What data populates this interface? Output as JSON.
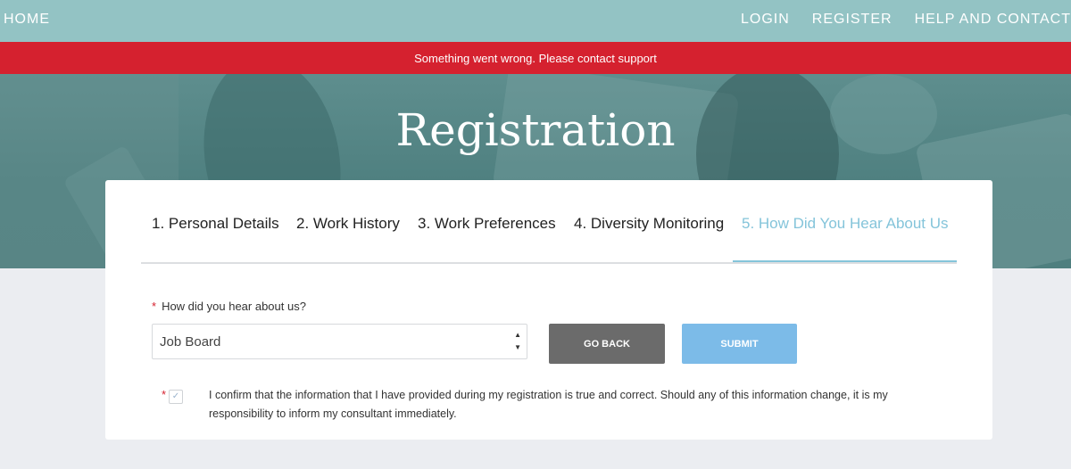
{
  "nav": {
    "home": "HOME",
    "login": "LOGIN",
    "register": "REGISTER",
    "help": "HELP AND CONTACT"
  },
  "error_banner": "Something went wrong. Please contact support",
  "hero": {
    "title": "Registration"
  },
  "steps": [
    {
      "label": "1. Personal Details",
      "active": false
    },
    {
      "label": "2. Work History",
      "active": false
    },
    {
      "label": "3. Work Preferences",
      "active": false
    },
    {
      "label": "4. Diversity Monitoring",
      "active": false
    },
    {
      "label": "5. How Did You Hear About Us",
      "active": true
    }
  ],
  "form": {
    "required_mark": "*",
    "question_label": "How did you hear about us?",
    "selected_value": "Job Board",
    "arrow_up": "▲",
    "arrow_down": "▼",
    "go_back_label": "GO BACK",
    "submit_label": "SUBMIT",
    "confirm_checked": true,
    "confirm_check_glyph": "✓",
    "confirm_text": "I confirm that the information that I have provided during my registration is true and correct. Should any of this information change, it is my responsibility to inform my consultant immediately."
  },
  "colors": {
    "nav_bg": "#93c3c4",
    "error_bg": "#d5212f",
    "active_step": "#84c4da",
    "go_back_bg": "#6b6b6b",
    "submit_bg": "#7cbbe8"
  },
  "icons": {
    "select_arrows": "up-down-arrows-icon",
    "checkbox": "checkmark-icon"
  }
}
